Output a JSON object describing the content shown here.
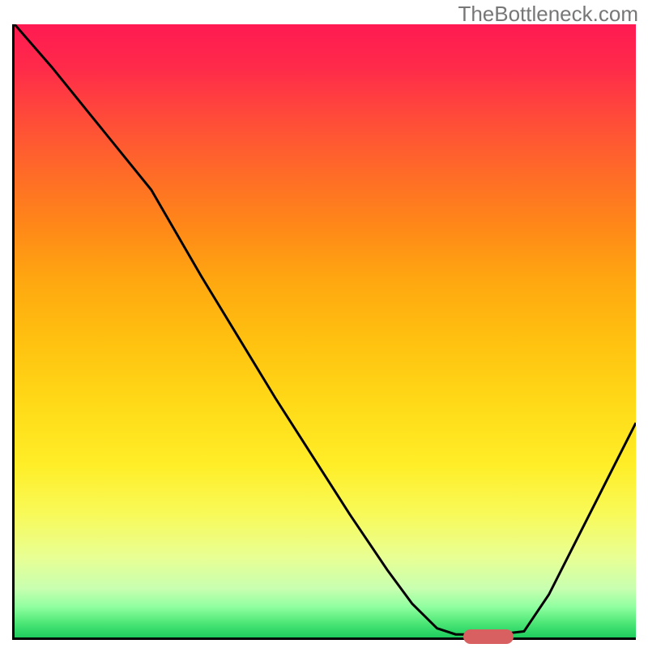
{
  "watermark": "TheBottleneck.com",
  "chart_data": {
    "type": "line",
    "title": "",
    "xlabel": "",
    "ylabel": "",
    "xlim": [
      0,
      100
    ],
    "ylim": [
      0,
      100
    ],
    "series": [
      {
        "name": "bottleneck-curve",
        "x": [
          0,
          6,
          12,
          18,
          22,
          26,
          30,
          36,
          42,
          48,
          54,
          60,
          64,
          68,
          71,
          74,
          78,
          82,
          86,
          90,
          94,
          100
        ],
        "y": [
          100,
          93,
          85.5,
          78,
          73,
          66,
          59,
          49,
          39,
          29.5,
          20,
          11,
          5.5,
          1.5,
          0.5,
          0.5,
          0.5,
          1,
          7,
          15,
          23,
          35
        ]
      }
    ],
    "optimal_zone": {
      "x_start": 72,
      "x_end": 80,
      "y": 0.5
    },
    "gradient_stops": [
      {
        "pct": 0,
        "color": "#FF1A52"
      },
      {
        "pct": 50,
        "color": "#FFC210"
      },
      {
        "pct": 80,
        "color": "#F8FA5A"
      },
      {
        "pct": 100,
        "color": "#20CC5E"
      }
    ]
  }
}
